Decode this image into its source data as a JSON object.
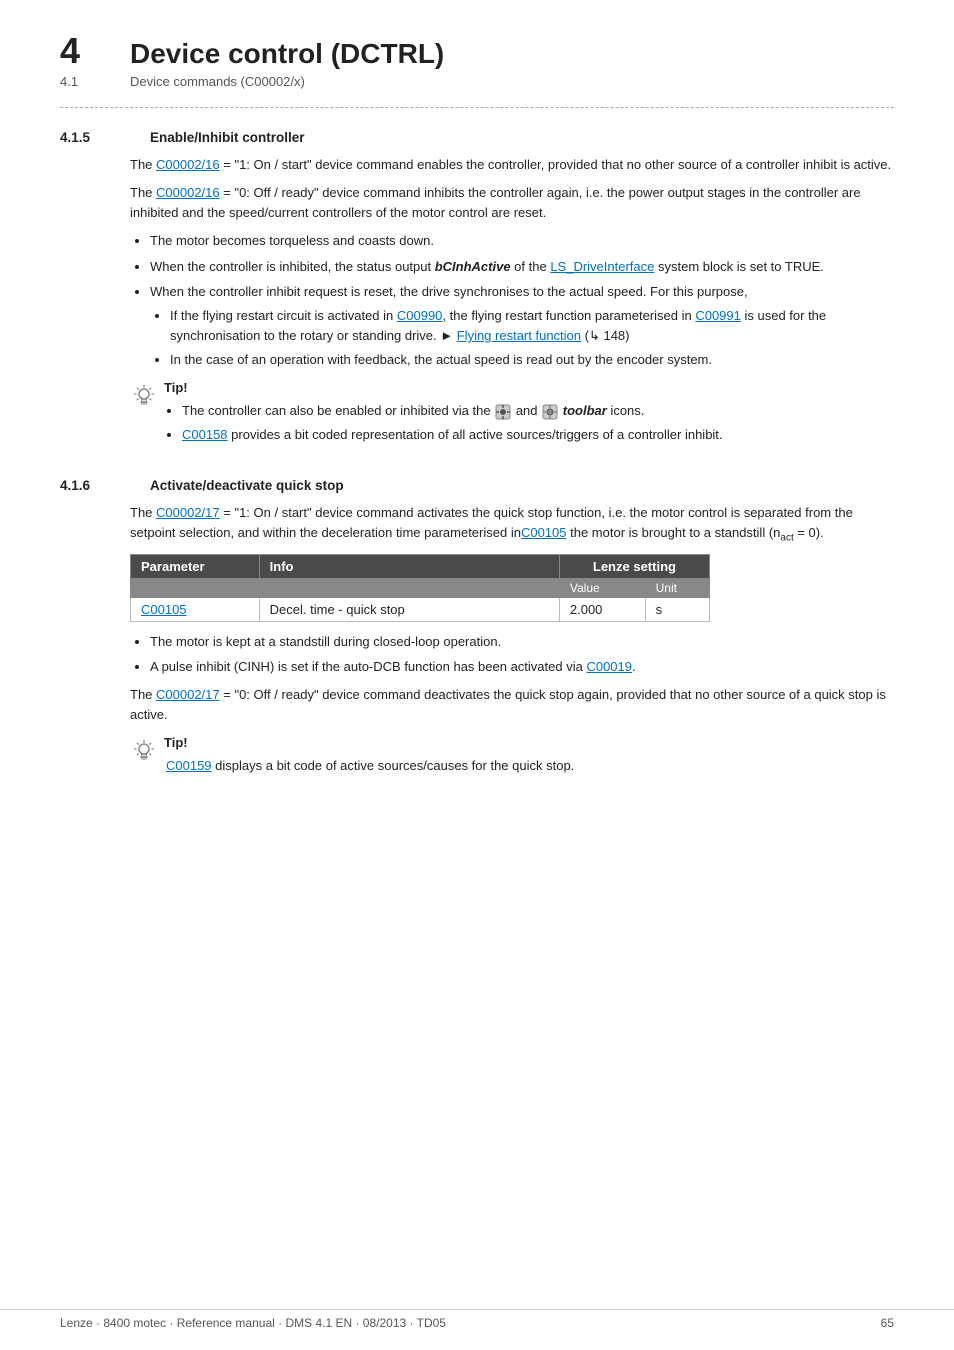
{
  "chapter": {
    "number": "4",
    "title": "Device control (DCTRL)"
  },
  "section": {
    "number": "4.1",
    "title": "Device commands (C00002/x)"
  },
  "subsections": [
    {
      "id": "4.1.5",
      "number": "4.1.5",
      "title": "Enable/Inhibit controller",
      "paragraphs": [
        {
          "id": "p1",
          "html": "The <a class='link' href='#'>C00002/16</a> = \"1: On / start\" device command enables the controller, provided that no other source of a controller inhibit is active."
        },
        {
          "id": "p2",
          "html": "The <a class='link' href='#'>C00002/16</a> = \"0: Off / ready\" device command inhibits the controller again, i.e. the power output stages in the controller are inhibited and the speed/current controllers of the motor control are reset."
        }
      ],
      "bullets": [
        "The motor becomes torqueless and coasts down.",
        "When the controller is inhibited, the status output <em><strong>bCInhActive</strong></em> of the <a class='link' href='#'>LS_DriveInterface</a> system block is set to TRUE.",
        "When the controller inhibit request is reset, the drive synchronises to the actual speed. For this purpose,"
      ],
      "sub_bullets": [
        "If the flying restart circuit is activated in <a class='link' href='#'>C00990</a>, the flying restart function parameterised in <a class='link' href='#'>C00991</a> is used for the synchronisation to the rotary or standing drive. &#9658; <a class='link' href='#'>Flying restart function</a> (&#x21b3; 148)",
        "In the case of an operation with feedback, the actual speed is read out by the encoder system."
      ],
      "tip": {
        "label": "Tip!",
        "bullets": [
          "The controller can also be enabled or inhibited via the <strong><em>toolbar</em></strong> icons.",
          "<a class='link' href='#'>C00158</a> provides a bit coded representation of all active sources/triggers of a controller inhibit."
        ]
      }
    },
    {
      "id": "4.1.6",
      "number": "4.1.6",
      "title": "Activate/deactivate quick stop",
      "paragraphs": [
        {
          "id": "p1",
          "html": "The <a class='link' href='#'>C00002/17</a> = \"1: On / start\" device command activates the quick stop function, i.e. the motor control is separated from the setpoint selection, and within the deceleration time parameterised in<a class='link' href='#'>C00105</a> the motor is brought to a standstill (n<sub>act</sub> = 0)."
        }
      ],
      "table": {
        "headers": [
          "Parameter",
          "Info",
          "Lenze setting"
        ],
        "subheaders": [
          "",
          "",
          "Value",
          "Unit"
        ],
        "rows": [
          [
            "C00105",
            "Decel. time - quick stop",
            "2.000",
            "s"
          ]
        ]
      },
      "bullets_after_table": [
        "The motor is kept at a standstill during closed-loop operation.",
        "A pulse inhibit (CINH) is set if the auto-DCB function has been activated via <a class='link' href='#'>C00019</a>."
      ],
      "paragraph_after_bullets": {
        "html": "The <a class='link' href='#'>C00002/17</a> = \"0: Off / ready\" device command deactivates the quick stop again, provided that no other source of a quick stop is active."
      },
      "tip": {
        "label": "Tip!",
        "text": "<a class='link' href='#'>C00159</a> displays a bit code of active sources/causes for the quick stop."
      }
    }
  ],
  "footer": {
    "left": "Lenze · 8400 motec · Reference manual · DMS 4.1 EN · 08/2013 · TD05",
    "right": "65"
  }
}
